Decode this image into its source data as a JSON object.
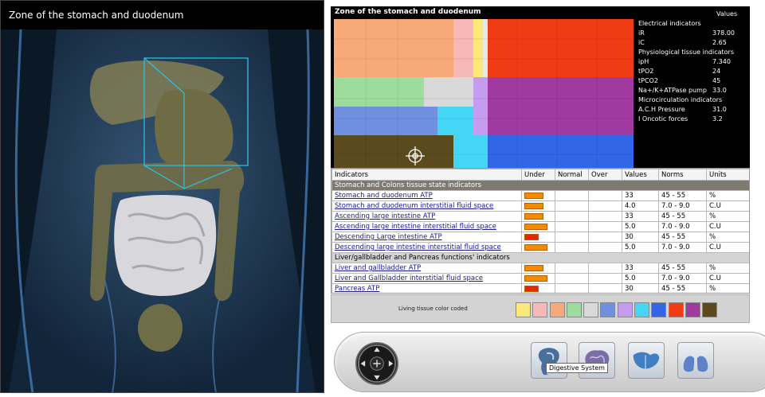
{
  "left_panel": {
    "title": "Zone of the stomach and duodenum"
  },
  "scan_panel": {
    "title": "Zone of the stomach and duodenum",
    "values_header": "Values",
    "readings": [
      {
        "label": "Electrical indicators",
        "value": ""
      },
      {
        "label": "iR",
        "value": "378.00"
      },
      {
        "label": "iC",
        "value": "2.65"
      },
      {
        "label": "Physiological  tissue indicators",
        "value": ""
      },
      {
        "label": "ipH",
        "value": "7.340"
      },
      {
        "label": "tPO2",
        "value": "24"
      },
      {
        "label": "tPCO2",
        "value": "45"
      },
      {
        "label": "Na+/K+ATPase pump",
        "value": "33.0"
      },
      {
        "label": "Microcirculation indicators",
        "value": ""
      },
      {
        "label": "A.C.H Pressure",
        "value": "31.0"
      },
      {
        "label": "I Oncotic forces",
        "value": "3.2"
      }
    ]
  },
  "table": {
    "headers": [
      "Indicators",
      "Under",
      "Normal",
      "Over",
      "Values",
      "Norms",
      "Units"
    ],
    "section1": "Stomach and Colons tissue state indicators",
    "section2": "Liver/gallbladder and Pancreas functions' indicators",
    "rows": [
      {
        "name": "Stomach and duodenum ATP",
        "value": "33",
        "norm": "45 - 55",
        "unit": "%",
        "level": 0.66,
        "color": "#f28b00"
      },
      {
        "name": "Stomach and duodenum interstitial fluid space",
        "value": "4.0",
        "norm": "7.0 - 9.0",
        "unit": "C.U",
        "level": 0.66,
        "color": "#f28b00"
      },
      {
        "name": "Ascending large intestine ATP",
        "value": "33",
        "norm": "45 - 55",
        "unit": "%",
        "level": 0.66,
        "color": "#f28b00"
      },
      {
        "name": "Ascending large intestine interstitial fluid space",
        "value": "5.0",
        "norm": "7.0 - 9.0",
        "unit": "C.U",
        "level": 0.8,
        "color": "#f28b00"
      },
      {
        "name": "Descending Large intestine ATP",
        "value": "30",
        "norm": "45 - 55",
        "unit": "%",
        "level": 0.5,
        "color": "#e32800"
      },
      {
        "name": "Descending large intestine interstitial fluid space",
        "value": "5.0",
        "norm": "7.0 - 9.0",
        "unit": "C.U",
        "level": 0.8,
        "color": "#f28b00"
      }
    ],
    "rows2": [
      {
        "name": "Liver and gallbladder ATP",
        "value": "33",
        "norm": "45 - 55",
        "unit": "%",
        "level": 0.66,
        "color": "#f28b00"
      },
      {
        "name": "Liver and Gallbladder interstitial fluid space",
        "value": "5.0",
        "norm": "7.0 - 9.0",
        "unit": "C.U",
        "level": 0.8,
        "color": "#f28b00"
      },
      {
        "name": "Pancreas ATP",
        "value": "30",
        "norm": "45 - 55",
        "unit": "%",
        "level": 0.5,
        "color": "#e32800"
      }
    ]
  },
  "legend": {
    "label": "Living tissue color coded",
    "colors": [
      "#fbe87a",
      "#f7b8b8",
      "#f7a978",
      "#9edc9e",
      "#d9d9d9",
      "#6f8fdf",
      "#c69cf0",
      "#45d6f6",
      "#3366e6",
      "#f03c14",
      "#a03aa0",
      "#5a4a1e"
    ]
  },
  "toolbar": {
    "tooltip": "Digestive System",
    "buttons": [
      "digestive-system",
      "brain",
      "liver",
      "lungs"
    ]
  }
}
